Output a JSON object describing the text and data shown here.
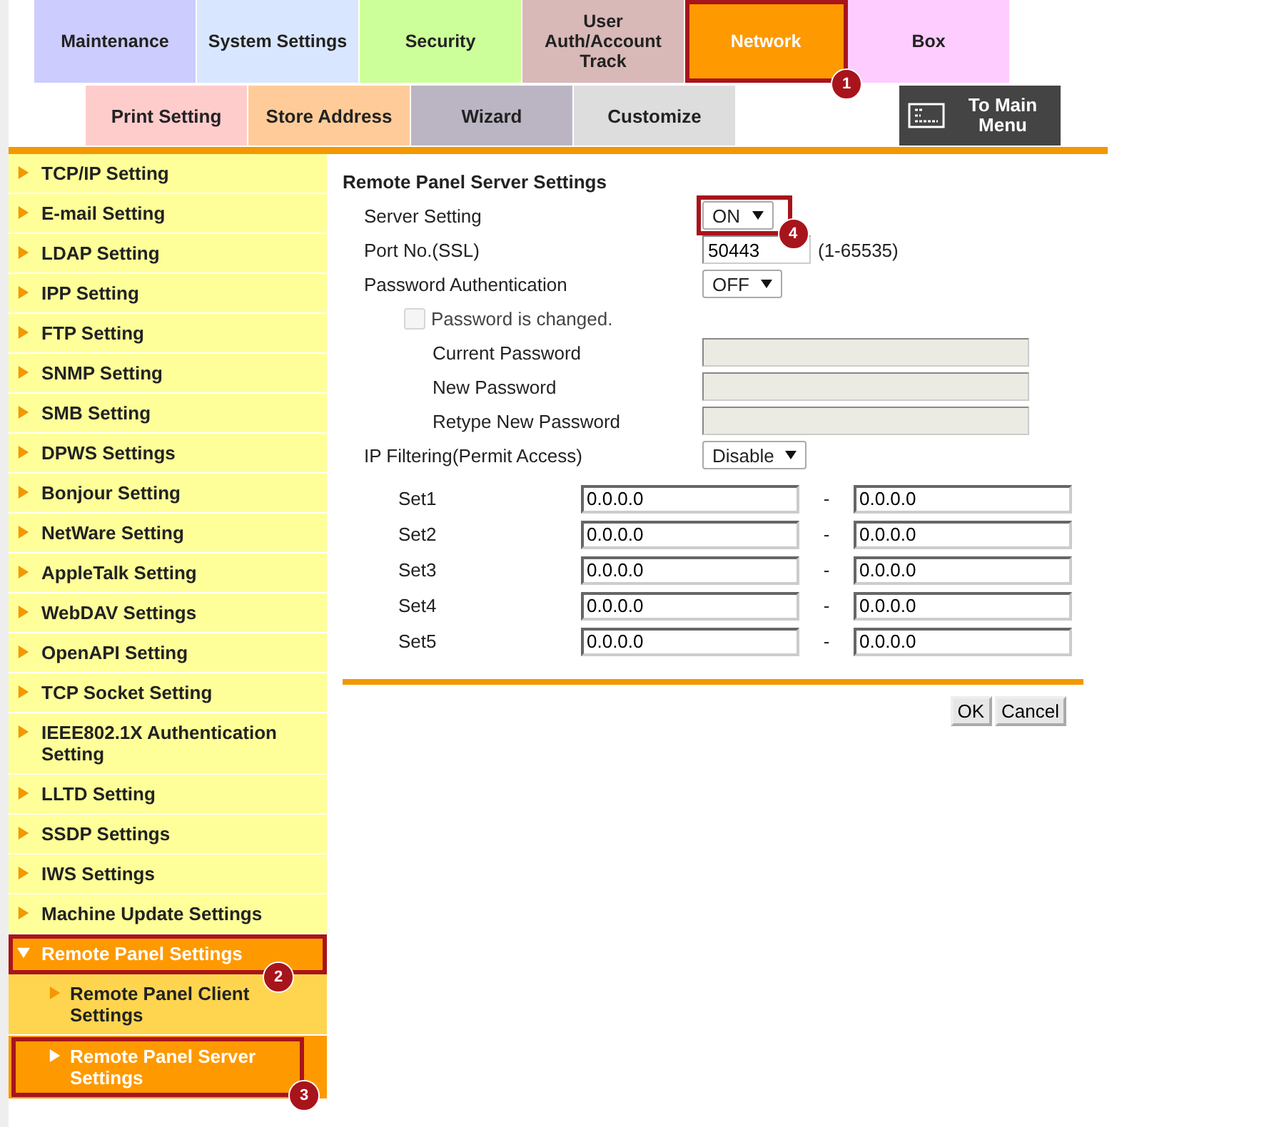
{
  "main_tabs": [
    {
      "label": "Maintenance",
      "color": "#ccccff",
      "selected": false
    },
    {
      "label": "System Settings",
      "color": "#d9e6ff",
      "selected": false
    },
    {
      "label": "Security",
      "color": "#ccff99",
      "selected": false
    },
    {
      "label": "User Auth/Account Track",
      "color": "#d9b8b8",
      "selected": false
    },
    {
      "label": "Network",
      "color": "#ff9900",
      "selected": true,
      "callout": "1"
    },
    {
      "label": "Box",
      "color": "#ffccff",
      "selected": false
    }
  ],
  "sub_tabs": [
    {
      "label": "Print Setting",
      "color": "#ffcccc"
    },
    {
      "label": "Store Address",
      "color": "#ffcc99"
    },
    {
      "label": "Wizard",
      "color": "#bbb5c3"
    },
    {
      "label": "Customize",
      "color": "#dddddd"
    }
  ],
  "main_menu_button": {
    "label": "To Main Menu"
  },
  "sidebar": {
    "items": [
      {
        "label": "TCP/IP Setting",
        "expanded": false
      },
      {
        "label": "E-mail Setting",
        "expanded": false
      },
      {
        "label": "LDAP Setting",
        "expanded": false
      },
      {
        "label": "IPP Setting",
        "expanded": false
      },
      {
        "label": "FTP Setting",
        "expanded": false
      },
      {
        "label": "SNMP Setting",
        "expanded": false
      },
      {
        "label": "SMB Setting",
        "expanded": false
      },
      {
        "label": "DPWS Settings",
        "expanded": false
      },
      {
        "label": "Bonjour Setting",
        "expanded": false
      },
      {
        "label": "NetWare Setting",
        "expanded": false
      },
      {
        "label": "AppleTalk Setting",
        "expanded": false
      },
      {
        "label": "WebDAV Settings",
        "expanded": false
      },
      {
        "label": "OpenAPI Setting",
        "expanded": false
      },
      {
        "label": "TCP Socket Setting",
        "expanded": false
      },
      {
        "label": "IEEE802.1X Authentication Setting",
        "expanded": false
      },
      {
        "label": "LLTD Setting",
        "expanded": false
      },
      {
        "label": "SSDP Settings",
        "expanded": false
      },
      {
        "label": "IWS Settings",
        "expanded": false
      },
      {
        "label": "Machine Update Settings",
        "expanded": false
      },
      {
        "label": "Remote Panel Settings",
        "expanded": true,
        "callout": "2",
        "children": [
          {
            "label": "Remote Panel Client Settings",
            "selected": false
          },
          {
            "label": "Remote Panel Server Settings",
            "selected": true,
            "callout": "3"
          }
        ]
      }
    ]
  },
  "form": {
    "title": "Remote Panel Server Settings",
    "rows": [
      {
        "kind": "select",
        "label": "Server Setting",
        "value": "ON",
        "callout": "4"
      },
      {
        "kind": "text",
        "label": "Port No.(SSL)",
        "value": "50443",
        "hint": "(1-65535)"
      },
      {
        "kind": "select",
        "label": "Password Authentication",
        "value": "OFF"
      },
      {
        "kind": "checkbox",
        "label": "Password is changed.",
        "checked": false,
        "disabled": true
      },
      {
        "kind": "password",
        "label": "Current Password",
        "disabled": true
      },
      {
        "kind": "password",
        "label": "New Password",
        "disabled": true
      },
      {
        "kind": "password",
        "label": "Retype New Password",
        "disabled": true
      },
      {
        "kind": "select",
        "label": "IP Filtering(Permit Access)",
        "value": "Disable"
      }
    ],
    "ip_sets": [
      {
        "label": "Set1",
        "from": "0.0.0.0",
        "dash": "-",
        "to": "0.0.0.0"
      },
      {
        "label": "Set2",
        "from": "0.0.0.0",
        "dash": "-",
        "to": "0.0.0.0"
      },
      {
        "label": "Set3",
        "from": "0.0.0.0",
        "dash": "-",
        "to": "0.0.0.0"
      },
      {
        "label": "Set4",
        "from": "0.0.0.0",
        "dash": "-",
        "to": "0.0.0.0"
      },
      {
        "label": "Set5",
        "from": "0.0.0.0",
        "dash": "-",
        "to": "0.0.0.0"
      }
    ],
    "buttons": [
      "OK",
      "Cancel"
    ]
  }
}
